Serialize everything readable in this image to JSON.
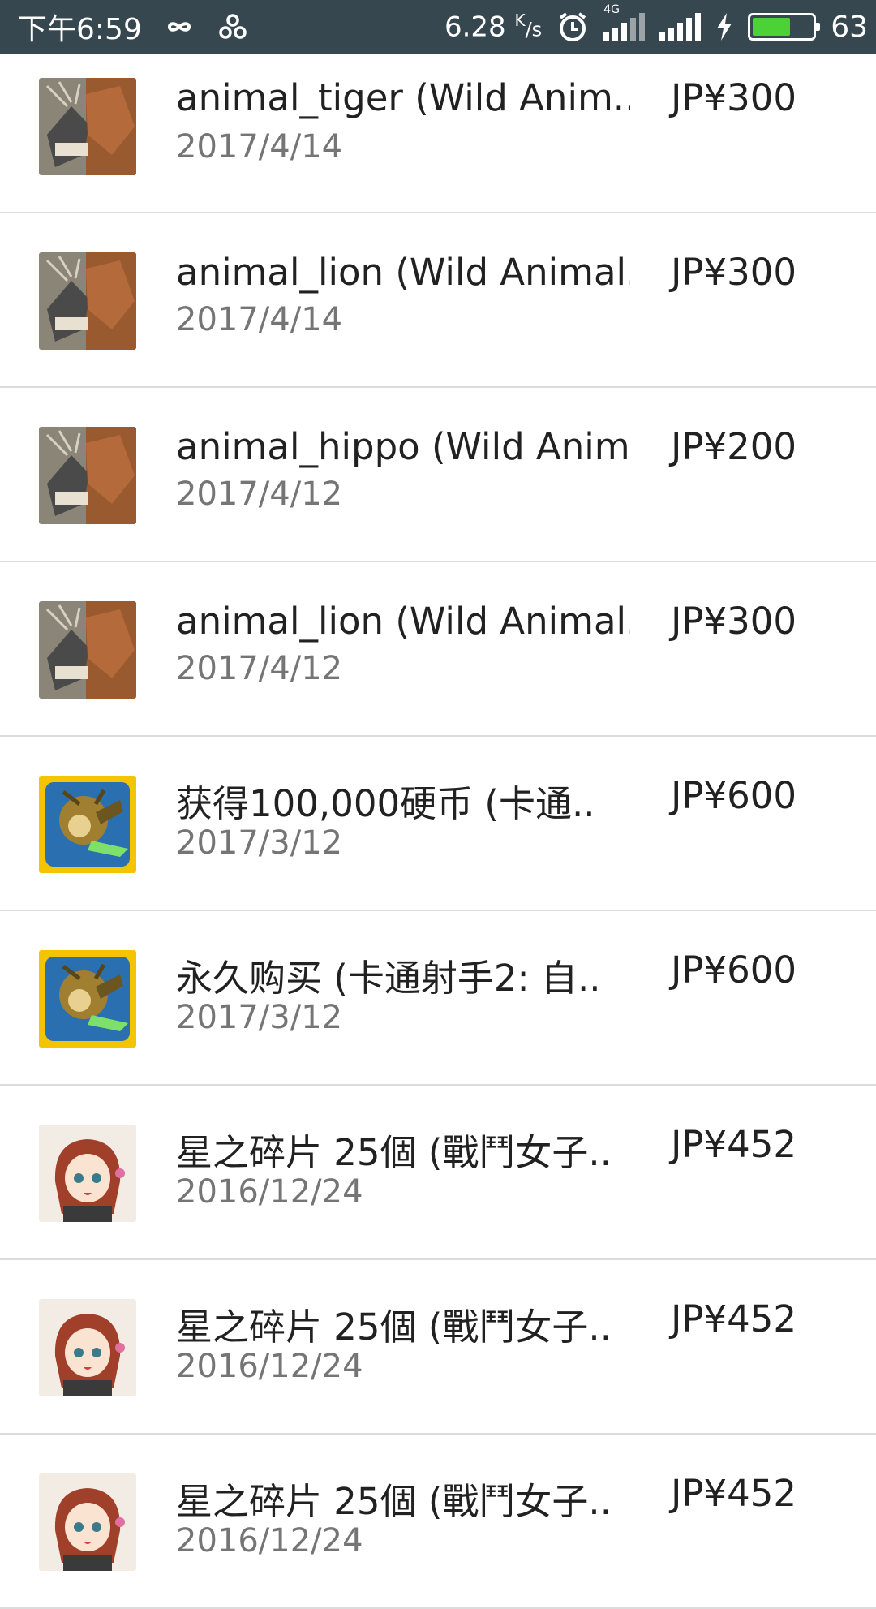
{
  "status_bar": {
    "time": "下午6:59",
    "net_speed_value": "6.28",
    "net_speed_unit": "K",
    "net_speed_unit_sub": "/s",
    "network_type": "4G",
    "battery_level": "63"
  },
  "purchases": [
    {
      "title": "animal_tiger (Wild Anim..",
      "date": "2017/4/14",
      "price": "JP¥300",
      "icon": "wild-animal-app-icon"
    },
    {
      "title": "animal_lion (Wild Animal..",
      "date": "2017/4/14",
      "price": "JP¥300",
      "icon": "wild-animal-app-icon"
    },
    {
      "title": "animal_hippo (Wild Anim..",
      "date": "2017/4/12",
      "price": "JP¥200",
      "icon": "wild-animal-app-icon"
    },
    {
      "title": "animal_lion (Wild Animal..",
      "date": "2017/4/12",
      "price": "JP¥300",
      "icon": "wild-animal-app-icon"
    },
    {
      "title": "获得100,000硬币 (卡通..",
      "date": "2017/3/12",
      "price": "JP¥600",
      "icon": "cartoon-shooter-app-icon"
    },
    {
      "title": "永久购买 (卡通射手2: 自..",
      "date": "2017/3/12",
      "price": "JP¥600",
      "icon": "cartoon-shooter-app-icon"
    },
    {
      "title": "星之碎片 25個 (戰鬥女子..",
      "date": "2016/12/24",
      "price": "JP¥452",
      "icon": "battle-girl-app-icon"
    },
    {
      "title": "星之碎片 25個 (戰鬥女子..",
      "date": "2016/12/24",
      "price": "JP¥452",
      "icon": "battle-girl-app-icon"
    },
    {
      "title": "星之碎片 25個 (戰鬥女子..",
      "date": "2016/12/24",
      "price": "JP¥452",
      "icon": "battle-girl-app-icon"
    }
  ],
  "colors": {
    "status_bar_bg": "#37474f",
    "battery_fill": "#4cd137",
    "title_text": "#212121",
    "date_text": "#757575",
    "divider": "#dcdcdc"
  }
}
